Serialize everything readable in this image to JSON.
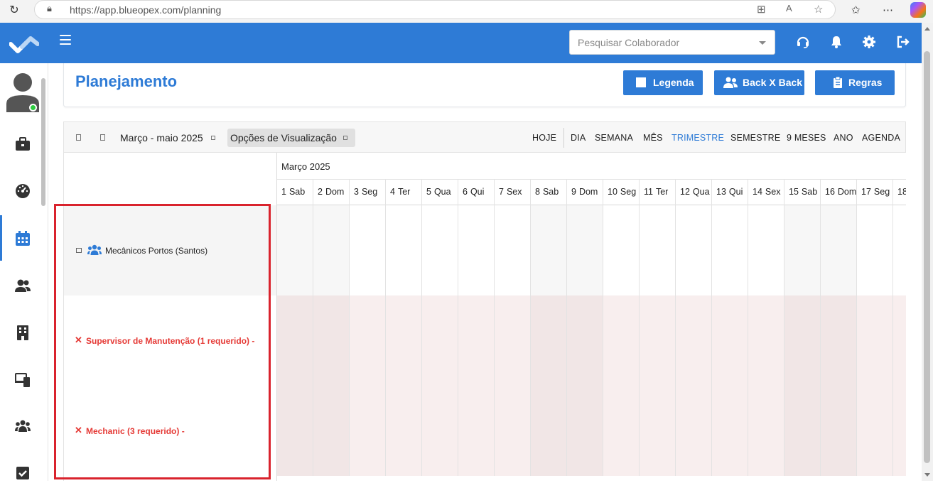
{
  "browser": {
    "url": "https://app.blueopex.com/planning"
  },
  "header": {
    "search_placeholder": "Pesquisar Colaborador",
    "brand_color": "#2e7bd6",
    "icons": [
      "headset-icon",
      "bell-icon",
      "gear-icon",
      "logout-icon"
    ]
  },
  "sidebar": {
    "items": [
      {
        "name": "briefcase-icon"
      },
      {
        "name": "dashboard-icon"
      },
      {
        "name": "calendar-icon",
        "active": true
      },
      {
        "name": "users-icon"
      },
      {
        "name": "building-icon"
      },
      {
        "name": "devices-icon"
      },
      {
        "name": "team-icon"
      },
      {
        "name": "checkbox-icon"
      }
    ]
  },
  "page": {
    "title": "Planejamento",
    "buttons": {
      "legenda": "Legenda",
      "backxback": "Back X Back",
      "regras": "Regras"
    }
  },
  "scheduler": {
    "range": "Março - maio 2025",
    "options": "Opções de Visualização",
    "views": {
      "hoje": "HOJE",
      "dia": "DIA",
      "semana": "SEMANA",
      "mes": "MÊS",
      "trimestre": "TRIMESTRE",
      "semestre": "SEMESTRE",
      "nove_meses": "9 MESES",
      "ano": "ANO",
      "agenda": "AGENDA"
    },
    "active_view": "TRIMESTRE",
    "month": "Março 2025",
    "days": [
      {
        "num": "1",
        "dow": "Sab"
      },
      {
        "num": "2",
        "dow": "Dom"
      },
      {
        "num": "3",
        "dow": "Seg"
      },
      {
        "num": "4",
        "dow": "Ter"
      },
      {
        "num": "5",
        "dow": "Qua"
      },
      {
        "num": "6",
        "dow": "Qui"
      },
      {
        "num": "7",
        "dow": "Sex"
      },
      {
        "num": "8",
        "dow": "Sab"
      },
      {
        "num": "9",
        "dow": "Dom"
      },
      {
        "num": "10",
        "dow": "Seg"
      },
      {
        "num": "11",
        "dow": "Ter"
      },
      {
        "num": "12",
        "dow": "Qua"
      },
      {
        "num": "13",
        "dow": "Qui"
      },
      {
        "num": "14",
        "dow": "Sex"
      },
      {
        "num": "15",
        "dow": "Sab"
      },
      {
        "num": "16",
        "dow": "Dom"
      },
      {
        "num": "17",
        "dow": "Seg"
      },
      {
        "num": "18",
        "dow": ""
      }
    ],
    "group": {
      "label": "Mecânicos Portos (Santos)"
    },
    "requirements": [
      {
        "label": "Supervisor de Manutenção (1 requerido) -"
      },
      {
        "label": "Mechanic (3 requerido) -"
      }
    ],
    "requirement_color": "#e53935",
    "highlight_color": "#d9232d"
  }
}
